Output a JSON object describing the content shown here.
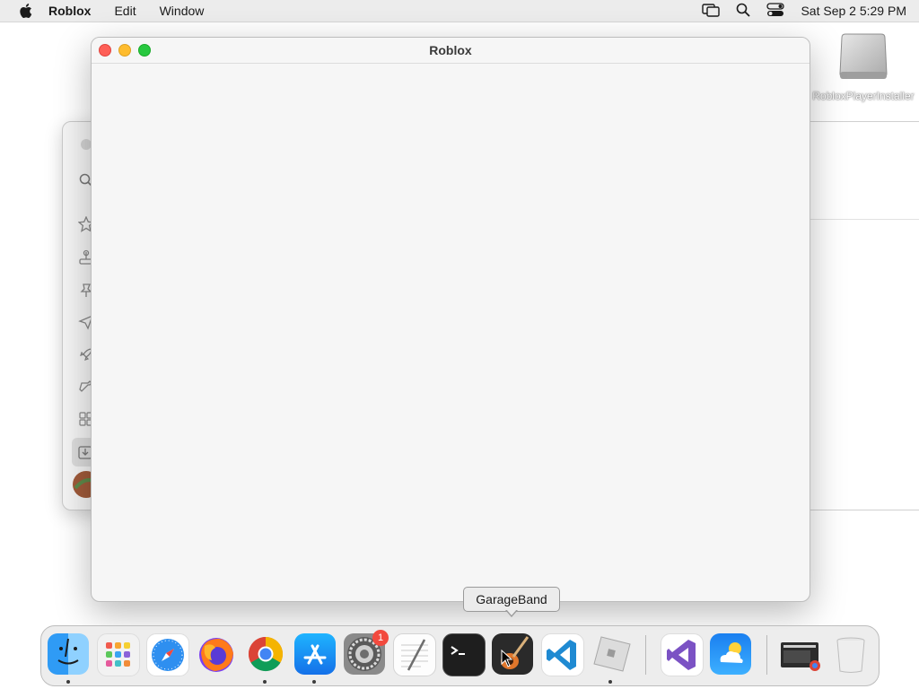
{
  "menubar": {
    "apple_icon": "apple-icon",
    "app_name": "Roblox",
    "items": [
      "Edit",
      "Window"
    ],
    "status_icons": [
      "screen-mirroring-icon",
      "spotlight-search-icon",
      "control-center-icon"
    ],
    "clock": "Sat Sep 2  5:29 PM"
  },
  "desktop": {
    "icon_label": "RobloxPlayerInstaller"
  },
  "window": {
    "title": "Roblox"
  },
  "background_window": {
    "sidebar_icons": [
      "circle-icon",
      "search-icon",
      "star-icon",
      "arcade-icon",
      "pin-icon",
      "paper-plane-icon",
      "rocket-icon",
      "hammer-icon",
      "grid-icon",
      "download-icon",
      "avatar-icon"
    ]
  },
  "dock": {
    "tooltip": "GarageBand",
    "apps": [
      "Finder",
      "Launchpad",
      "Safari",
      "Firefox",
      "Google Chrome",
      "App Store",
      "System Settings",
      "TextEdit",
      "Terminal",
      "GarageBand",
      "Visual Studio Code",
      "Roblox",
      "Visual Studio",
      "Weather",
      "Downloads",
      "Trash"
    ],
    "settings_badge": "1"
  },
  "colors": {
    "close": "#fe5f57",
    "minimize": "#febc2e",
    "maximize": "#28c840",
    "badge": "#f24a3e"
  }
}
